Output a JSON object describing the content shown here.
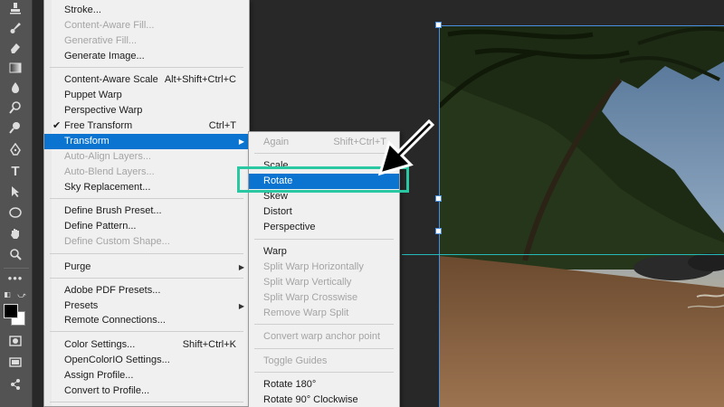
{
  "edit_menu": {
    "items": [
      {
        "label": "Stroke...",
        "shortcut": "",
        "disabled": false
      },
      {
        "label": "Content-Aware Fill...",
        "shortcut": "",
        "disabled": true
      },
      {
        "label": "Generative Fill...",
        "shortcut": "",
        "disabled": true
      },
      {
        "label": "Generate Image...",
        "shortcut": "",
        "disabled": false
      },
      {
        "label": "Content-Aware Scale",
        "shortcut": "Alt+Shift+Ctrl+C",
        "disabled": false
      },
      {
        "label": "Puppet Warp",
        "shortcut": "",
        "disabled": false
      },
      {
        "label": "Perspective Warp",
        "shortcut": "",
        "disabled": false
      },
      {
        "label": "Free Transform",
        "shortcut": "Ctrl+T",
        "disabled": false,
        "checked": true
      },
      {
        "label": "Transform",
        "shortcut": "",
        "disabled": false,
        "submenu": true,
        "highlighted": true
      },
      {
        "label": "Auto-Align Layers...",
        "shortcut": "",
        "disabled": true
      },
      {
        "label": "Auto-Blend Layers...",
        "shortcut": "",
        "disabled": true
      },
      {
        "label": "Sky Replacement...",
        "shortcut": "",
        "disabled": false
      },
      {
        "label": "Define Brush Preset...",
        "shortcut": "",
        "disabled": false
      },
      {
        "label": "Define Pattern...",
        "shortcut": "",
        "disabled": false
      },
      {
        "label": "Define Custom Shape...",
        "shortcut": "",
        "disabled": true
      },
      {
        "label": "Purge",
        "shortcut": "",
        "disabled": false,
        "submenu": true
      },
      {
        "label": "Adobe PDF Presets...",
        "shortcut": "",
        "disabled": false
      },
      {
        "label": "Presets",
        "shortcut": "",
        "disabled": false,
        "submenu": true
      },
      {
        "label": "Remote Connections...",
        "shortcut": "",
        "disabled": false
      },
      {
        "label": "Color Settings...",
        "shortcut": "Shift+Ctrl+K",
        "disabled": false
      },
      {
        "label": "OpenColorIO Settings...",
        "shortcut": "",
        "disabled": false
      },
      {
        "label": "Assign Profile...",
        "shortcut": "",
        "disabled": false
      },
      {
        "label": "Convert to Profile...",
        "shortcut": "",
        "disabled": false
      }
    ]
  },
  "transform_menu": {
    "items": [
      {
        "label": "Again",
        "shortcut": "Shift+Ctrl+T",
        "disabled": true
      },
      {
        "label": "Scale",
        "shortcut": "",
        "disabled": false
      },
      {
        "label": "Rotate",
        "shortcut": "",
        "disabled": false,
        "highlighted": true
      },
      {
        "label": "Skew",
        "shortcut": "",
        "disabled": false
      },
      {
        "label": "Distort",
        "shortcut": "",
        "disabled": false
      },
      {
        "label": "Perspective",
        "shortcut": "",
        "disabled": false
      },
      {
        "label": "Warp",
        "shortcut": "",
        "disabled": false
      },
      {
        "label": "Split Warp Horizontally",
        "shortcut": "",
        "disabled": true
      },
      {
        "label": "Split Warp Vertically",
        "shortcut": "",
        "disabled": true
      },
      {
        "label": "Split Warp Crosswise",
        "shortcut": "",
        "disabled": true
      },
      {
        "label": "Remove Warp Split",
        "shortcut": "",
        "disabled": true
      },
      {
        "label": "Convert warp anchor point",
        "shortcut": "",
        "disabled": true
      },
      {
        "label": "Toggle Guides",
        "shortcut": "",
        "disabled": true
      },
      {
        "label": "Rotate 180°",
        "shortcut": "",
        "disabled": false
      },
      {
        "label": "Rotate 90° Clockwise",
        "shortcut": "",
        "disabled": false
      }
    ]
  },
  "toolbar": {
    "tools": [
      "stamp-icon",
      "history-brush-icon",
      "eraser-icon",
      "gradient-icon",
      "blur-icon",
      "dodge-icon",
      "pen-icon",
      "type-icon",
      "path-selection-icon",
      "ellipse-icon",
      "hand-icon",
      "zoom-icon",
      "more-tools-icon"
    ]
  },
  "colors": {
    "highlight": "#0b74d1",
    "annotation": "#2ac7a3",
    "guide": "#26c9c9",
    "bounding_box": "#4a90e2"
  }
}
